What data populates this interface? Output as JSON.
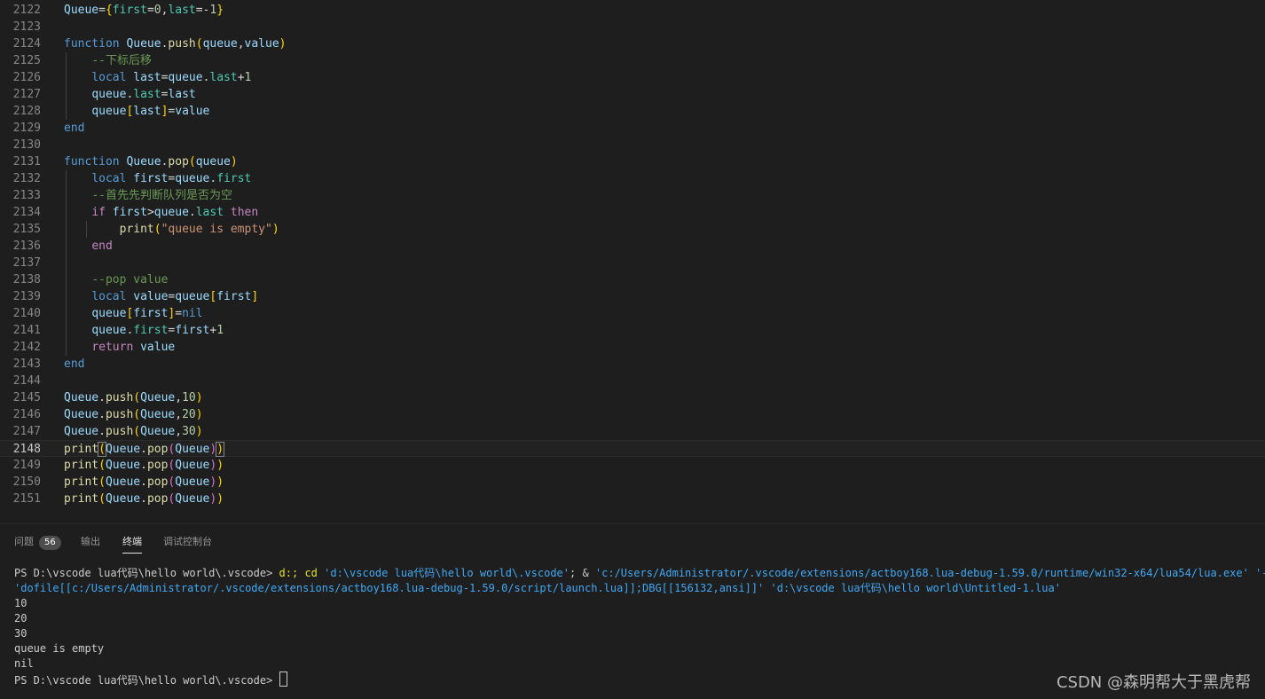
{
  "editor": {
    "lines": [
      {
        "num": "2122",
        "tokens": [
          [
            "t-var",
            "Queue"
          ],
          [
            "t-op",
            "="
          ],
          [
            "t-br1",
            "{"
          ],
          [
            "t-prop",
            "first"
          ],
          [
            "t-op",
            "="
          ],
          [
            "t-num",
            "0"
          ],
          [
            "t-op",
            ","
          ],
          [
            "t-prop",
            "last"
          ],
          [
            "t-op",
            "=-"
          ],
          [
            "t-num",
            "1"
          ],
          [
            "t-br1",
            "}"
          ]
        ]
      },
      {
        "num": "2123",
        "tokens": []
      },
      {
        "num": "2124",
        "tokens": [
          [
            "t-kw",
            "function "
          ],
          [
            "t-var",
            "Queue"
          ],
          [
            "t-op",
            "."
          ],
          [
            "t-fn",
            "push"
          ],
          [
            "t-br1",
            "("
          ],
          [
            "t-var",
            "queue"
          ],
          [
            "t-op",
            ","
          ],
          [
            "t-var",
            "value"
          ],
          [
            "t-br1",
            ")"
          ]
        ]
      },
      {
        "num": "2125",
        "tokens": [
          [
            "t-op",
            "    "
          ],
          [
            "t-com",
            "--下标后移"
          ]
        ]
      },
      {
        "num": "2126",
        "tokens": [
          [
            "t-op",
            "    "
          ],
          [
            "t-kw",
            "local "
          ],
          [
            "t-var",
            "last"
          ],
          [
            "t-op",
            "="
          ],
          [
            "t-var",
            "queue"
          ],
          [
            "t-op",
            "."
          ],
          [
            "t-prop",
            "last"
          ],
          [
            "t-op",
            "+"
          ],
          [
            "t-num",
            "1"
          ]
        ]
      },
      {
        "num": "2127",
        "tokens": [
          [
            "t-op",
            "    "
          ],
          [
            "t-var",
            "queue"
          ],
          [
            "t-op",
            "."
          ],
          [
            "t-prop",
            "last"
          ],
          [
            "t-op",
            "="
          ],
          [
            "t-var",
            "last"
          ]
        ]
      },
      {
        "num": "2128",
        "tokens": [
          [
            "t-op",
            "    "
          ],
          [
            "t-var",
            "queue"
          ],
          [
            "t-br1",
            "["
          ],
          [
            "t-var",
            "last"
          ],
          [
            "t-br1",
            "]"
          ],
          [
            "t-op",
            "="
          ],
          [
            "t-var",
            "value"
          ]
        ]
      },
      {
        "num": "2129",
        "tokens": [
          [
            "t-kw",
            "end"
          ]
        ]
      },
      {
        "num": "2130",
        "tokens": []
      },
      {
        "num": "2131",
        "tokens": [
          [
            "t-kw",
            "function "
          ],
          [
            "t-var",
            "Queue"
          ],
          [
            "t-op",
            "."
          ],
          [
            "t-fn",
            "pop"
          ],
          [
            "t-br1",
            "("
          ],
          [
            "t-var",
            "queue"
          ],
          [
            "t-br1",
            ")"
          ]
        ]
      },
      {
        "num": "2132",
        "tokens": [
          [
            "t-op",
            "    "
          ],
          [
            "t-kw",
            "local "
          ],
          [
            "t-var",
            "first"
          ],
          [
            "t-op",
            "="
          ],
          [
            "t-var",
            "queue"
          ],
          [
            "t-op",
            "."
          ],
          [
            "t-prop",
            "first"
          ]
        ]
      },
      {
        "num": "2133",
        "tokens": [
          [
            "t-op",
            "    "
          ],
          [
            "t-com",
            "--首先先判断队列是否为空"
          ]
        ]
      },
      {
        "num": "2134",
        "tokens": [
          [
            "t-op",
            "    "
          ],
          [
            "t-ctl",
            "if "
          ],
          [
            "t-var",
            "first"
          ],
          [
            "t-op",
            ">"
          ],
          [
            "t-var",
            "queue"
          ],
          [
            "t-op",
            "."
          ],
          [
            "t-prop",
            "last"
          ],
          [
            "t-ctl",
            " then"
          ]
        ]
      },
      {
        "num": "2135",
        "tokens": [
          [
            "t-op",
            "        "
          ],
          [
            "t-fn",
            "print"
          ],
          [
            "t-br1",
            "("
          ],
          [
            "t-str",
            "\"queue is empty\""
          ],
          [
            "t-br1",
            ")"
          ]
        ]
      },
      {
        "num": "2136",
        "tokens": [
          [
            "t-op",
            "    "
          ],
          [
            "t-ctl",
            "end"
          ]
        ]
      },
      {
        "num": "2137",
        "tokens": []
      },
      {
        "num": "2138",
        "tokens": [
          [
            "t-op",
            "    "
          ],
          [
            "t-com",
            "--pop value"
          ]
        ]
      },
      {
        "num": "2139",
        "tokens": [
          [
            "t-op",
            "    "
          ],
          [
            "t-kw",
            "local "
          ],
          [
            "t-var",
            "value"
          ],
          [
            "t-op",
            "="
          ],
          [
            "t-var",
            "queue"
          ],
          [
            "t-br1",
            "["
          ],
          [
            "t-var",
            "first"
          ],
          [
            "t-br1",
            "]"
          ]
        ]
      },
      {
        "num": "2140",
        "tokens": [
          [
            "t-op",
            "    "
          ],
          [
            "t-var",
            "queue"
          ],
          [
            "t-br1",
            "["
          ],
          [
            "t-var",
            "first"
          ],
          [
            "t-br1",
            "]"
          ],
          [
            "t-op",
            "="
          ],
          [
            "t-kw",
            "nil"
          ]
        ]
      },
      {
        "num": "2141",
        "tokens": [
          [
            "t-op",
            "    "
          ],
          [
            "t-var",
            "queue"
          ],
          [
            "t-op",
            "."
          ],
          [
            "t-prop",
            "first"
          ],
          [
            "t-op",
            "="
          ],
          [
            "t-var",
            "first"
          ],
          [
            "t-op",
            "+"
          ],
          [
            "t-num",
            "1"
          ]
        ]
      },
      {
        "num": "2142",
        "tokens": [
          [
            "t-op",
            "    "
          ],
          [
            "t-ctl",
            "return "
          ],
          [
            "t-var",
            "value"
          ]
        ]
      },
      {
        "num": "2143",
        "tokens": [
          [
            "t-kw",
            "end"
          ]
        ]
      },
      {
        "num": "2144",
        "tokens": []
      },
      {
        "num": "2145",
        "tokens": [
          [
            "t-var",
            "Queue"
          ],
          [
            "t-op",
            "."
          ],
          [
            "t-fn",
            "push"
          ],
          [
            "t-br1",
            "("
          ],
          [
            "t-var",
            "Queue"
          ],
          [
            "t-op",
            ","
          ],
          [
            "t-num",
            "10"
          ],
          [
            "t-br1",
            ")"
          ]
        ]
      },
      {
        "num": "2146",
        "tokens": [
          [
            "t-var",
            "Queue"
          ],
          [
            "t-op",
            "."
          ],
          [
            "t-fn",
            "push"
          ],
          [
            "t-br1",
            "("
          ],
          [
            "t-var",
            "Queue"
          ],
          [
            "t-op",
            ","
          ],
          [
            "t-num",
            "20"
          ],
          [
            "t-br1",
            ")"
          ]
        ]
      },
      {
        "num": "2147",
        "tokens": [
          [
            "t-var",
            "Queue"
          ],
          [
            "t-op",
            "."
          ],
          [
            "t-fn",
            "push"
          ],
          [
            "t-br1",
            "("
          ],
          [
            "t-var",
            "Queue"
          ],
          [
            "t-op",
            ","
          ],
          [
            "t-num",
            "30"
          ],
          [
            "t-br1",
            ")"
          ]
        ]
      },
      {
        "num": "2148",
        "current": true,
        "tokens": [
          [
            "t-fn",
            "print"
          ],
          [
            "t-br1 bm",
            "("
          ],
          [
            "t-var",
            "Queue"
          ],
          [
            "t-op",
            "."
          ],
          [
            "t-fn",
            "pop"
          ],
          [
            "t-br2",
            "("
          ],
          [
            "t-var",
            "Queue"
          ],
          [
            "t-br2",
            ")"
          ],
          [
            "t-br1 bm",
            ")"
          ]
        ]
      },
      {
        "num": "2149",
        "tokens": [
          [
            "t-fn",
            "print"
          ],
          [
            "t-br1",
            "("
          ],
          [
            "t-var",
            "Queue"
          ],
          [
            "t-op",
            "."
          ],
          [
            "t-fn",
            "pop"
          ],
          [
            "t-br2",
            "("
          ],
          [
            "t-var",
            "Queue"
          ],
          [
            "t-br2",
            ")"
          ],
          [
            "t-br1",
            ")"
          ]
        ]
      },
      {
        "num": "2150",
        "tokens": [
          [
            "t-fn",
            "print"
          ],
          [
            "t-br1",
            "("
          ],
          [
            "t-var",
            "Queue"
          ],
          [
            "t-op",
            "."
          ],
          [
            "t-fn",
            "pop"
          ],
          [
            "t-br2",
            "("
          ],
          [
            "t-var",
            "Queue"
          ],
          [
            "t-br2",
            ")"
          ],
          [
            "t-br1",
            ")"
          ]
        ]
      },
      {
        "num": "2151",
        "tokens": [
          [
            "t-fn",
            "print"
          ],
          [
            "t-br1",
            "("
          ],
          [
            "t-var",
            "Queue"
          ],
          [
            "t-op",
            "."
          ],
          [
            "t-fn",
            "pop"
          ],
          [
            "t-br2",
            "("
          ],
          [
            "t-var",
            "Queue"
          ],
          [
            "t-br2",
            ")"
          ],
          [
            "t-br1",
            ")"
          ]
        ]
      }
    ]
  },
  "panel": {
    "tabs": {
      "problems": "问题",
      "problems_count": "56",
      "output": "输出",
      "terminal": "终端",
      "debug_console": "调试控制台"
    },
    "terminal": {
      "prompt1": "PS D:\\vscode lua代码\\hello world\\.vscode> ",
      "cmd_part1": "d:; cd ",
      "cmd_path": "'d:\\vscode lua代码\\hello world\\.vscode'",
      "cmd_part2": "; & ",
      "cmd_exe": "'c:/Users/Administrator/.vscode/extensions/actboy168.lua-debug-1.59.0/runtime/win32-x64/lua54/lua.exe' '-e'",
      "cmd_line2": "'dofile[[c:/Users/Administrator/.vscode/extensions/actboy168.lua-debug-1.59.0/script/launch.lua]];DBG[[156132,ansi]]' 'd:\\vscode lua代码\\hello world\\Untitled-1.lua'",
      "out1": "10",
      "out2": "20",
      "out3": "30",
      "out4": "queue is empty",
      "out5": "nil",
      "prompt2": "PS D:\\vscode lua代码\\hello world\\.vscode> "
    }
  },
  "watermark": "CSDN @森明帮大于黑虎帮"
}
